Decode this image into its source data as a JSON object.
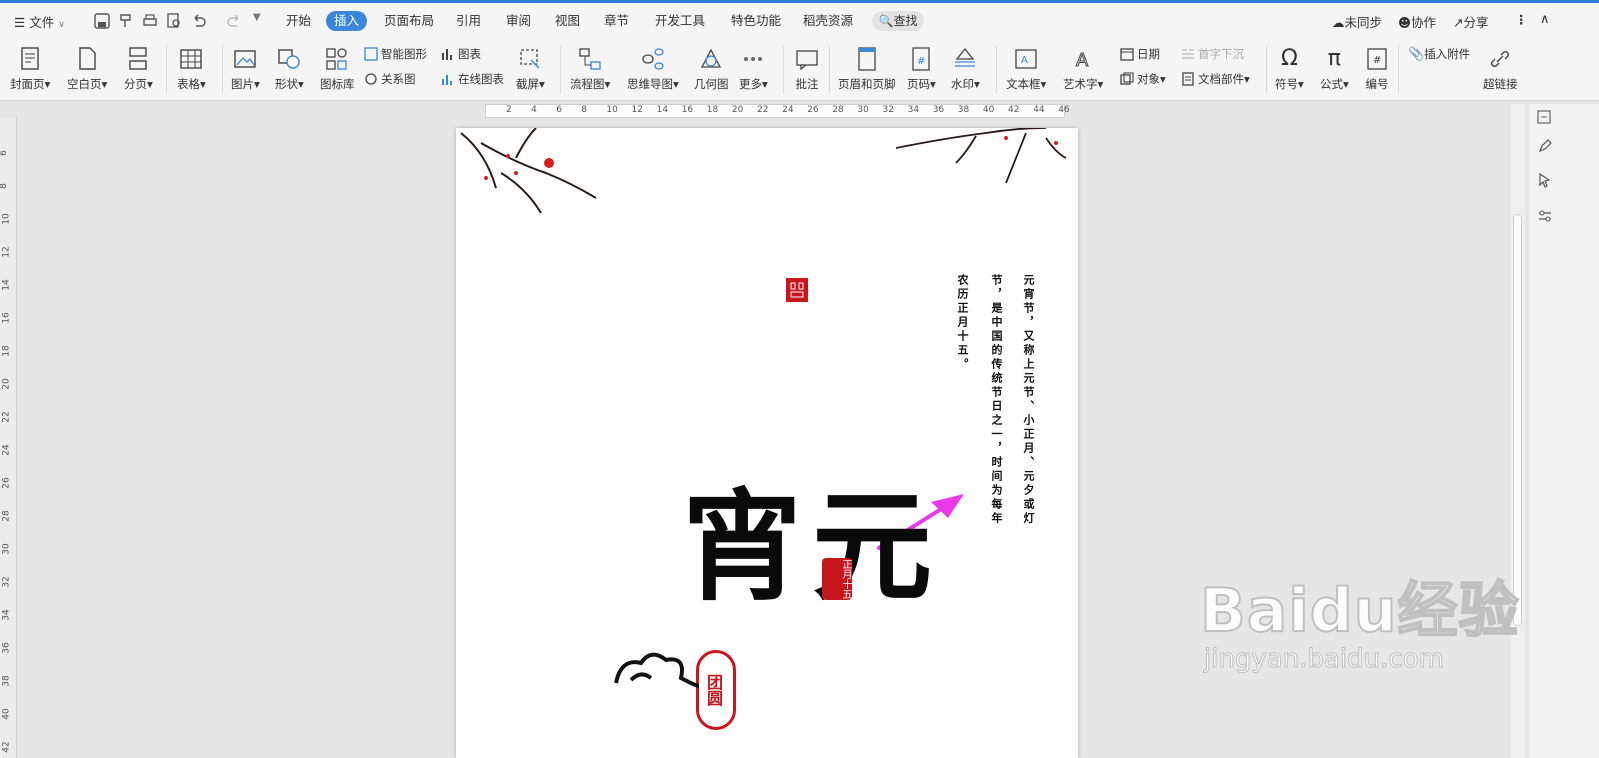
{
  "menubar": {
    "file_label": "文件",
    "tabs": [
      "开始",
      "插入",
      "页面布局",
      "引用",
      "审阅",
      "视图",
      "章节",
      "开发工具",
      "特色功能",
      "稻壳资源"
    ],
    "active_tab": "插入",
    "search_label": "查找",
    "right": {
      "sync_label": "未同步",
      "collab_label": "协作",
      "share_label": "分享"
    }
  },
  "ribbon": {
    "cover": "封面页",
    "blank": "空白页",
    "pagebreak": "分页",
    "table": "表格",
    "picture": "图片",
    "shape": "形状",
    "iconlib": "图标库",
    "smartart": "智能图形",
    "relation": "关系图",
    "chart": "图表",
    "online_chart": "在线图表",
    "screenshot": "截屏",
    "flowchart": "流程图",
    "mindmap": "思维导图",
    "geometry": "几何图",
    "more": "更多",
    "comment": "批注",
    "header_footer": "页眉和页脚",
    "page_number": "页码",
    "watermark": "水印",
    "textbox": "文本框",
    "wordart": "艺术字",
    "date": "日期",
    "object": "对象",
    "dropcap": "首字下沉",
    "doc_parts": "文档部件",
    "symbol": "符号",
    "formula": "公式",
    "numbering": "编号",
    "attachment": "插入附件",
    "hyperlink": "超链接"
  },
  "ruler": {
    "h_numbers": [
      "2",
      "4",
      "6",
      "8",
      "10",
      "12",
      "14",
      "16",
      "18",
      "20",
      "22",
      "24",
      "26",
      "28",
      "30",
      "32",
      "34",
      "36",
      "38",
      "40",
      "42",
      "44",
      "46"
    ],
    "v_numbers": [
      "6",
      "8",
      "10",
      "12",
      "14",
      "16",
      "18",
      "20",
      "22",
      "24",
      "26",
      "28",
      "30",
      "32",
      "34",
      "36",
      "38",
      "40",
      "42"
    ]
  },
  "document": {
    "col1": "元宵节，又称上元节、小正月、元夕或灯",
    "col2": "节，是中国的传统节日之一，时间为每年",
    "col3": "农历正月十五。",
    "seal_small": "正月十五",
    "seal_round": "团圆",
    "calligraphy": "元宵"
  },
  "watermark": {
    "brand": "Baidu经验",
    "url": "jingyan.baidu.com"
  },
  "colors": {
    "accent": "#3b86d9",
    "arrow": "#e83ae8",
    "seal_red": "#c8161d"
  }
}
